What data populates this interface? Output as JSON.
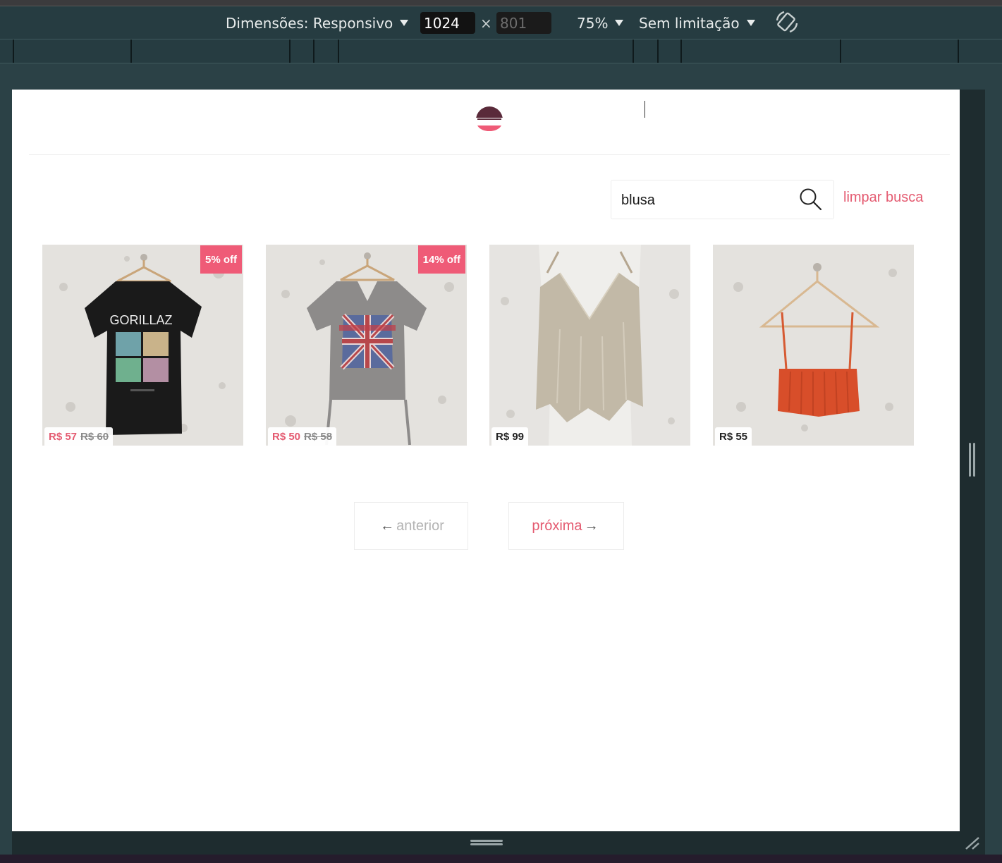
{
  "devtools": {
    "dimensions_label": "Dimensões: Responsivo",
    "width_value": "1024",
    "height_placeholder": "801",
    "times_symbol": "×",
    "zoom_label": "75%",
    "throttle_label": "Sem limitação",
    "rotate_icon": "rotate-device-icon"
  },
  "colors": {
    "accent": "#e45a70",
    "badge": "#ef5b77",
    "logo_dark": "#5a2a3a",
    "logo_pink": "#ef5b77"
  },
  "search": {
    "value": "blusa",
    "icon": "search-icon",
    "clear_label": "limpar busca"
  },
  "products": [
    {
      "name": "camiseta-gorillaz",
      "graphic_text": "GORILLAZ",
      "badge": "5% off",
      "price": "R$ 57",
      "old_price": "R$ 60",
      "on_sale": true
    },
    {
      "name": "camiseta-def-leppard",
      "badge": "14% off",
      "price": "R$ 50",
      "old_price": "R$ 58",
      "on_sale": true
    },
    {
      "name": "regata-paete",
      "badge": "",
      "price": "R$ 99",
      "old_price": "",
      "on_sale": false
    },
    {
      "name": "cropped-trico-laranja",
      "badge": "",
      "price": "R$ 55",
      "old_price": "",
      "on_sale": false
    }
  ],
  "pagination": {
    "prev_label": "anterior",
    "next_label": "próxima",
    "prev_arrow": "←",
    "next_arrow": "→"
  }
}
